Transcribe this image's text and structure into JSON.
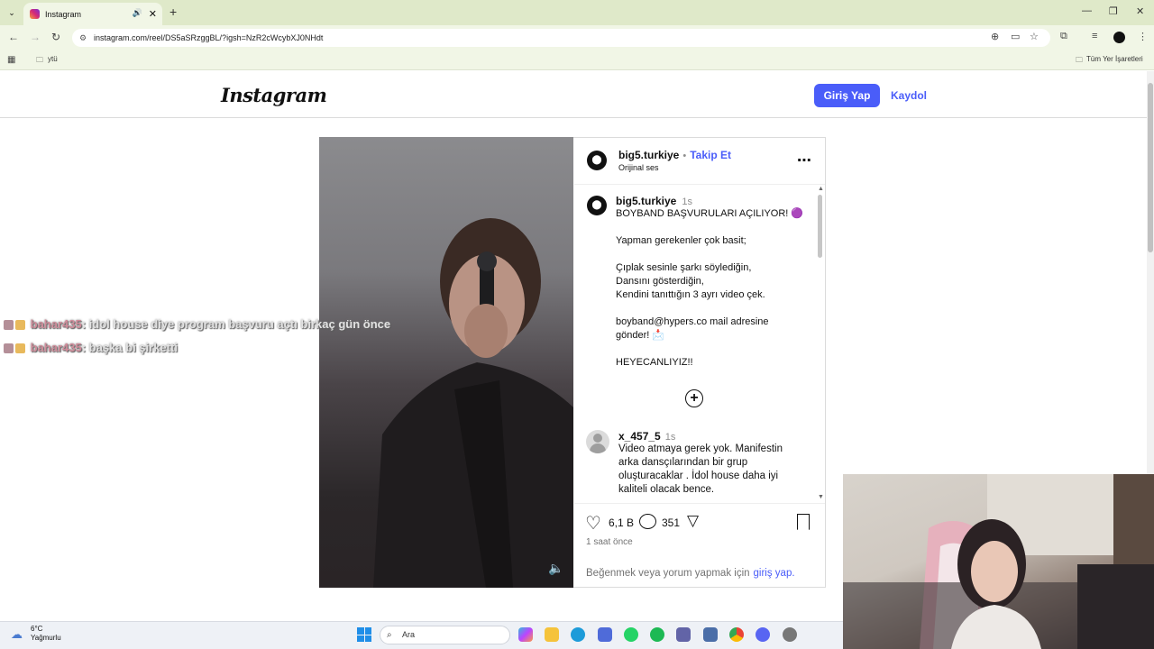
{
  "browser": {
    "tab_title": "Instagram",
    "url": "instagram.com/reel/DS5aSRzggBL/?igsh=NzR2cWcybXJ0NHdt",
    "bookmark_folder": "ytü",
    "all_bookmarks": "Tüm Yer İşaretleri"
  },
  "header": {
    "logo": "Instagram",
    "login_button": "Giriş Yap",
    "signup_link": "Kaydol"
  },
  "post": {
    "author": "big5.turkiye",
    "separator": "•",
    "follow_label": "Takip Et",
    "audio": "Orijinal ses",
    "caption_author": "big5.turkiye",
    "caption_time": "1s",
    "caption_lines": [
      "BOYBAND BAŞVURULARI AÇILIYOR! 🟣",
      "",
      "Yapman gerekenler çok basit;",
      "",
      "Çıplak sesinle şarkı söylediğin,",
      "Dansını gösterdiğin,",
      "Kendini tanıttığın 3 ayrı video çek.",
      "",
      "boyband@hypers.co mail adresine",
      "gönder! 📩",
      "",
      "HEYECANLIYIZ!!"
    ],
    "comment": {
      "user": "x_457_5",
      "time": "1s",
      "lines": [
        "Video atmaya gerek yok. Manifestin",
        "arka dansçılarından bir grup",
        "oluşturacaklar . İdol house daha iyi",
        "kaliteli olacak bence."
      ]
    },
    "likes": "6,1 B",
    "comments_count": "351",
    "posted": "1 saat önce",
    "login_prompt": "Beğenmek veya yorum yapmak için",
    "login_prompt_link": "giriş yap."
  },
  "stream_chat": [
    {
      "user": "bahar435",
      "message": ": idol house diye program başvuru açtı birkaç gün önce"
    },
    {
      "user": "bahar435",
      "message": ": başka bi şirketti"
    }
  ],
  "taskbar": {
    "weather_temp": "6°C",
    "weather_desc": "Yağmurlu",
    "search_placeholder": "Ara"
  }
}
